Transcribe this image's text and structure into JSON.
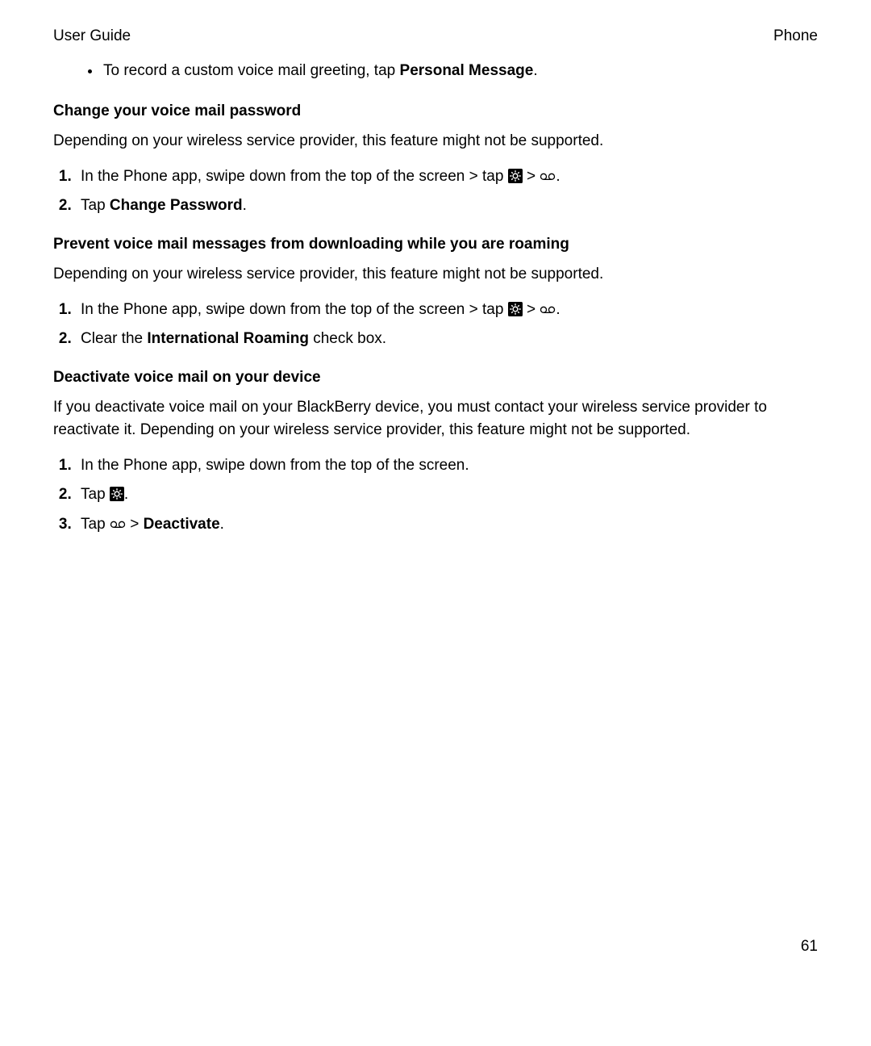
{
  "header": {
    "left": "User Guide",
    "right": "Phone"
  },
  "bullet1": {
    "pre": "To record a custom voice mail greeting, tap ",
    "bold": "Personal Message",
    "post": "."
  },
  "sec1": {
    "heading": "Change your voice mail password",
    "para": "Depending on your wireless service provider, this feature might not be supported.",
    "step1": {
      "pre": "In the Phone app, swipe down from the top of the screen > tap ",
      "mid": " > ",
      "post": "."
    },
    "step2": {
      "pre": "Tap ",
      "bold": "Change Password",
      "post": "."
    }
  },
  "sec2": {
    "heading": "Prevent voice mail messages from downloading while you are roaming",
    "para": "Depending on your wireless service provider, this feature might not be supported.",
    "step1": {
      "pre": "In the Phone app, swipe down from the top of the screen > tap ",
      "mid": " > ",
      "post": "."
    },
    "step2": {
      "pre": "Clear the ",
      "bold": "International Roaming",
      "post": " check box."
    }
  },
  "sec3": {
    "heading": "Deactivate voice mail on your device",
    "para": "If you deactivate voice mail on your BlackBerry device, you must contact your wireless service provider to reactivate it. Depending on your wireless service provider, this feature might not be supported.",
    "step1": "In the Phone app, swipe down from the top of the screen.",
    "step2": {
      "pre": "Tap ",
      "post": "."
    },
    "step3": {
      "pre": "Tap ",
      "mid": " > ",
      "bold": "Deactivate",
      "post": "."
    }
  },
  "pageNumber": "61"
}
